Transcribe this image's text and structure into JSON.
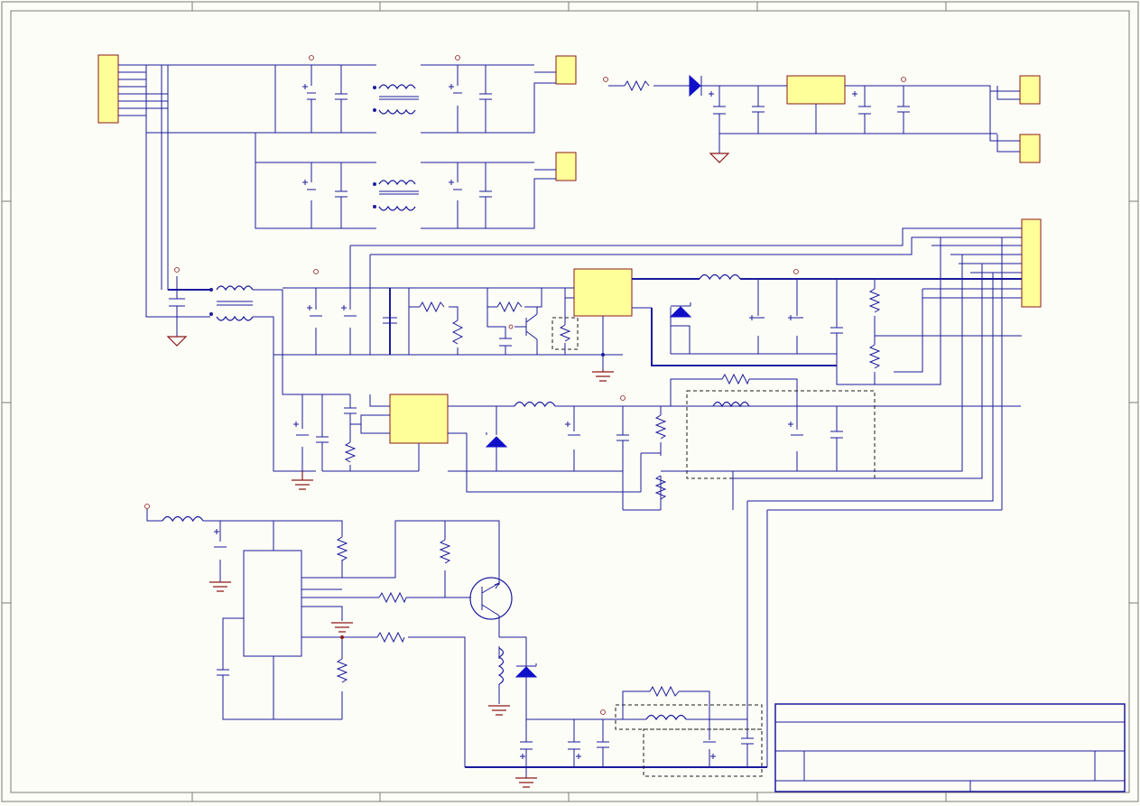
{
  "schematic": {
    "colors": {
      "wire": "#1b1b9e",
      "component_body": "#ffff99",
      "component_border": "#8b1a1a",
      "ground_symbol": "#8b1a1a",
      "sheet_background": "#fdfdf7",
      "frame": "#7a7a7a"
    },
    "symbols": [
      "connector",
      "resistor",
      "capacitor",
      "electrolytic-capacitor",
      "inductor",
      "common-mode-choke",
      "zener-diode",
      "diode",
      "npn-transistor",
      "pnp-transistor",
      "ic-block",
      "ground",
      "power-port",
      "shield-outline"
    ],
    "title_block": {
      "title": "",
      "size": "",
      "number": "",
      "revision": "",
      "date": "",
      "sheet": "",
      "file": "",
      "drawn_by": ""
    }
  }
}
